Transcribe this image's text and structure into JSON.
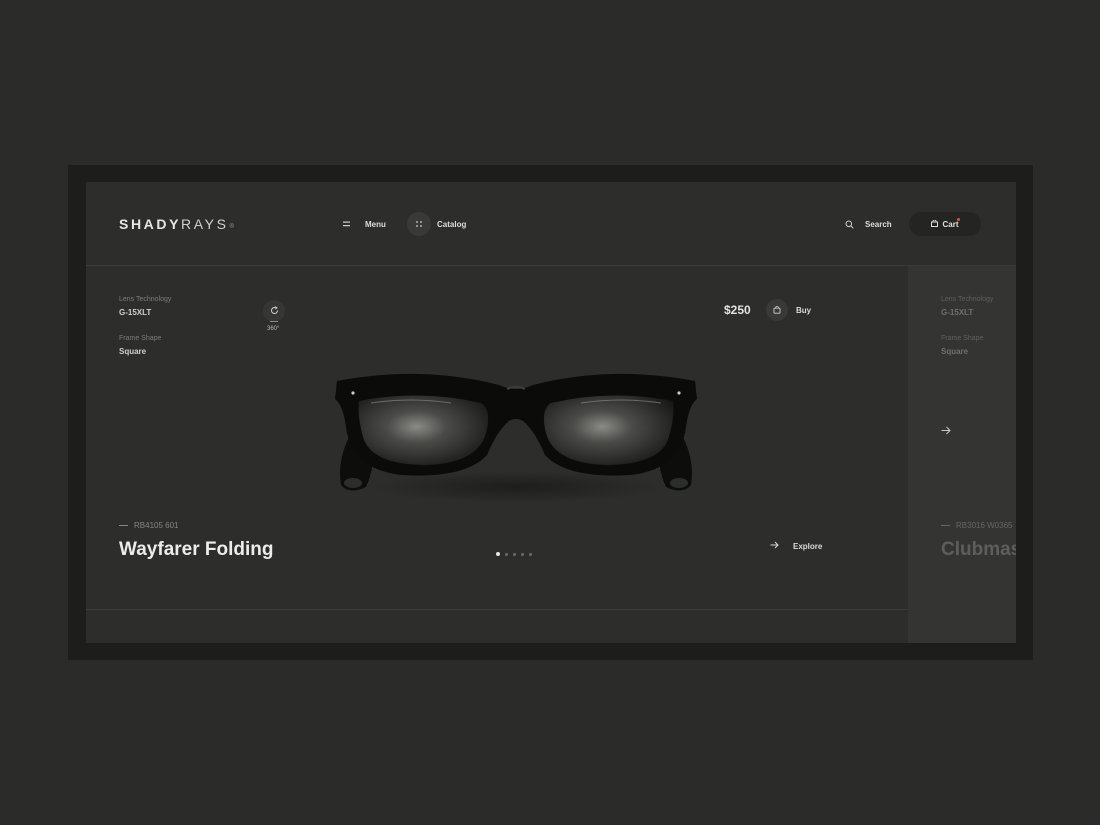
{
  "brand": {
    "name_bold": "SHADY",
    "name_light": "RAYS",
    "reg_mark": "®"
  },
  "nav": {
    "menu_label": "Menu",
    "catalog_label": "Catalog",
    "search_label": "Search",
    "cart_label": "Cart"
  },
  "product": {
    "lens_label": "Lens Technology",
    "lens_value": "G-15XLT",
    "frame_label": "Frame Shape",
    "frame_value": "Square",
    "rotate_label": "360°",
    "price": "$250",
    "buy_label": "Buy",
    "sku": "RB4105 601",
    "title": "Wayfarer Folding",
    "explore_label": "Explore",
    "slide_count": 5,
    "slide_active": 1
  },
  "next_product": {
    "lens_label": "Lens Technology",
    "lens_value": "G-15XLT",
    "frame_label": "Frame Shape",
    "frame_value": "Square",
    "sku": "RB3016 W0365",
    "title": "Clubmaster"
  },
  "colors": {
    "background": "#2b2c2a",
    "panel": "#2d2e2c",
    "accent_dot": "#d4543e"
  },
  "icons": [
    "menu-icon",
    "catalog-grid-icon",
    "search-icon",
    "cart-bag-icon",
    "rotate-icon",
    "bag-icon",
    "arrow-right-icon"
  ]
}
